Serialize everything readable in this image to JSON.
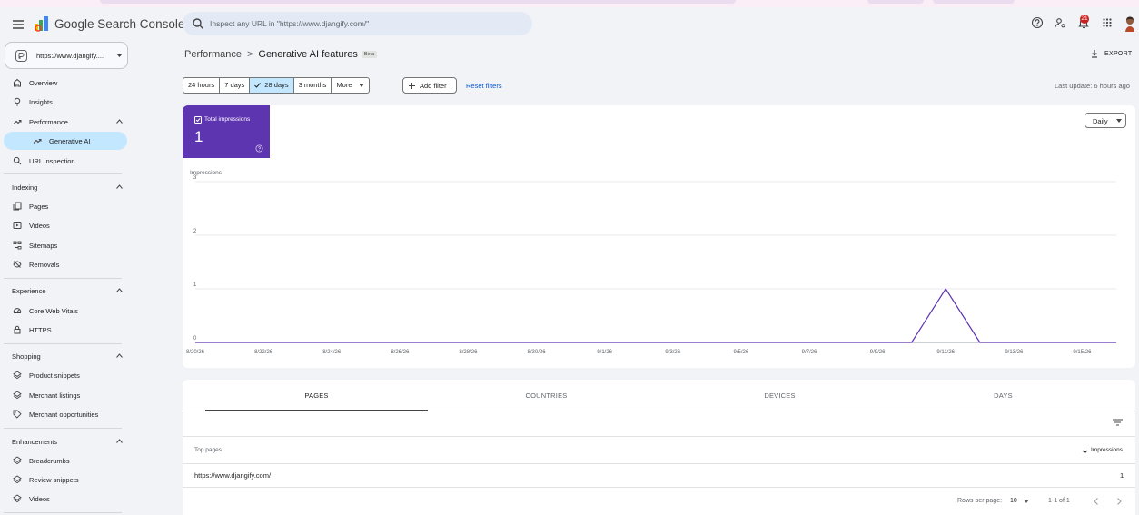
{
  "app": {
    "title": "Google Search Console",
    "colors": {
      "brand_purple": "#5e35b1",
      "selected_bg": "#c2e7ff",
      "link_blue": "#0b57d0",
      "background": "#f1f3f7",
      "badge_red": "#c5221f"
    }
  },
  "topbar": {
    "menu_icon": "hamburger-menu-icon",
    "search_placeholder": "Inspect any URL in \"https://www.djangify.com/\"",
    "search_icon": "search-icon",
    "icons": [
      "help-icon",
      "manage-users-icon",
      "notifications-icon",
      "apps-grid-icon",
      "profile-avatar"
    ],
    "notification_count": "21"
  },
  "sidebar": {
    "property": "https://www.djangify....",
    "items": [
      {
        "label": "Overview",
        "icon": "home-icon"
      },
      {
        "label": "Insights",
        "icon": "lightbulb-icon"
      },
      {
        "label": "Performance",
        "icon": "trending-up-icon",
        "expanded": true
      },
      {
        "label": "Generative AI",
        "icon": "trending-up-icon",
        "selected": true
      },
      {
        "label": "URL inspection",
        "icon": "search-icon"
      }
    ],
    "sections": [
      {
        "title": "Indexing",
        "items": [
          {
            "label": "Pages",
            "icon": "pages-icon"
          },
          {
            "label": "Videos",
            "icon": "video-icon"
          },
          {
            "label": "Sitemaps",
            "icon": "sitemap-icon"
          },
          {
            "label": "Removals",
            "icon": "visibility-off-icon"
          }
        ]
      },
      {
        "title": "Experience",
        "items": [
          {
            "label": "Core Web Vitals",
            "icon": "speed-icon"
          },
          {
            "label": "HTTPS",
            "icon": "lock-icon"
          }
        ]
      },
      {
        "title": "Shopping",
        "items": [
          {
            "label": "Product snippets",
            "icon": "layers-icon"
          },
          {
            "label": "Merchant listings",
            "icon": "layers-icon"
          },
          {
            "label": "Merchant opportunities",
            "icon": "tag-icon"
          }
        ]
      },
      {
        "title": "Enhancements",
        "items": [
          {
            "label": "Breadcrumbs",
            "icon": "layers-icon"
          },
          {
            "label": "Review snippets",
            "icon": "layers-icon"
          },
          {
            "label": "Videos",
            "icon": "layers-icon"
          }
        ]
      }
    ]
  },
  "header": {
    "breadcrumb_root": "Performance",
    "breadcrumb_sep": ">",
    "breadcrumb_current": "Generative AI features",
    "beta": "Beta",
    "export": "EXPORT"
  },
  "filters": {
    "date_ranges": [
      "24 hours",
      "7 days",
      "28 days",
      "3 months",
      "More"
    ],
    "selected_range": "28 days",
    "add_filter": "Add filter",
    "reset_filters": "Reset filters",
    "last_update": "Last update: 6 hours ago"
  },
  "metric": {
    "label": "Total impressions",
    "value": "1",
    "checked": true
  },
  "granularity": "Daily",
  "chart_data": {
    "type": "line",
    "ylabel": "Impressions",
    "ylim": [
      0,
      3
    ],
    "yticks": [
      "0",
      "1",
      "2",
      "3"
    ],
    "x_tick_labels": [
      "8/20/26",
      "8/22/26",
      "8/24/26",
      "8/26/26",
      "8/28/26",
      "8/30/26",
      "9/1/26",
      "9/3/26",
      "9/5/26",
      "9/7/26",
      "9/9/26",
      "9/11/26",
      "9/13/26",
      "9/15/26"
    ],
    "x": [
      "8/20/26",
      "8/21/26",
      "8/22/26",
      "8/23/26",
      "8/24/26",
      "8/25/26",
      "8/26/26",
      "8/27/26",
      "8/28/26",
      "8/29/26",
      "8/30/26",
      "8/31/26",
      "9/1/26",
      "9/2/26",
      "9/3/26",
      "9/4/26",
      "9/5/26",
      "9/6/26",
      "9/7/26",
      "9/8/26",
      "9/9/26",
      "9/10/26",
      "9/11/26",
      "9/12/26",
      "9/13/26",
      "9/14/26",
      "9/15/26",
      "9/16/26"
    ],
    "series": [
      {
        "name": "Impressions",
        "color": "#5e35b1",
        "values": [
          0,
          0,
          0,
          0,
          0,
          0,
          0,
          0,
          0,
          0,
          0,
          0,
          0,
          0,
          0,
          0,
          0,
          0,
          0,
          0,
          0,
          0,
          1,
          0,
          0,
          0,
          0,
          0
        ]
      }
    ],
    "grid": true
  },
  "tabs": [
    "PAGES",
    "COUNTRIES",
    "DEVICES",
    "DAYS"
  ],
  "active_tab": "PAGES",
  "table": {
    "headers": {
      "left": "Top pages",
      "right": "Impressions"
    },
    "rows": [
      {
        "page": "https://www.djangify.com/",
        "impressions": "1"
      }
    ],
    "rows_per_page_label": "Rows per page:",
    "rows_per_page": "10",
    "range": "1-1 of 1"
  }
}
